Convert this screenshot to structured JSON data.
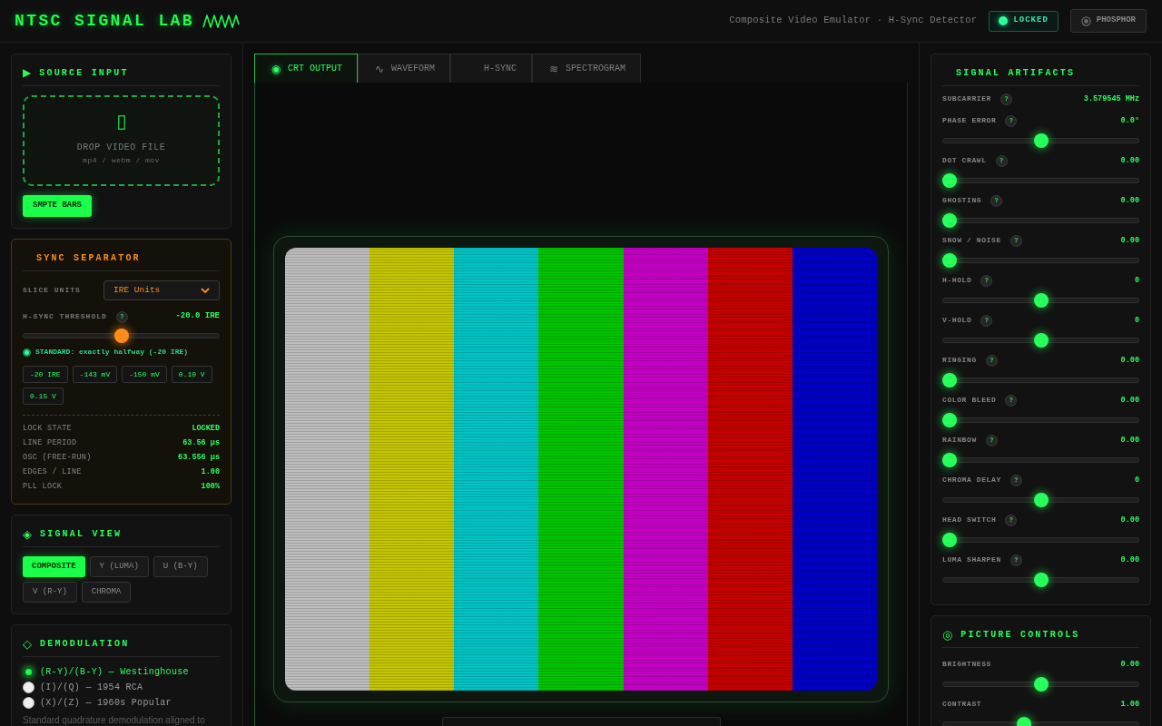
{
  "header": {
    "title": "NTSC SIGNAL LAB",
    "subtitle": "Composite Video Emulator · H-Sync Detector",
    "status": {
      "label": "LOCKED",
      "locked": true
    },
    "phosphor": {
      "label": "PHOSPHOR",
      "on": false
    }
  },
  "source_input": {
    "icon": "▶",
    "title": "SOURCE INPUT",
    "drop_zone": {
      "label": "DROP VIDEO FILE",
      "formats": "mp4 / webm / mov"
    },
    "button": {
      "label": "SMPTE BARS"
    }
  },
  "sync_separator": {
    "title": "SYNC SEPARATOR",
    "slice_units": {
      "label": "SLICE UNITS",
      "value": "IRE Units"
    },
    "threshold": {
      "label": "H-SYNC THRESHOLD",
      "help": "?",
      "reading": "-20.0 IRE",
      "level": 0.5
    },
    "standard": {
      "text": "STANDARD: exactly halfway (-20 IRE)",
      "on": true
    },
    "presets": [
      "-20 IRE",
      "-143 mV",
      "-150 mV",
      "0.10 V",
      "0.15 V"
    ],
    "stats": [
      {
        "label": "LOCK STATE",
        "value": "LOCKED"
      },
      {
        "label": "LINE PERIOD",
        "value": "63.56 µs"
      },
      {
        "label": "OSC (FREE-RUN)",
        "value": "63.556 µs"
      },
      {
        "label": "EDGES / LINE",
        "value": "1.00"
      },
      {
        "label": "PLL LOCK",
        "value": "100%"
      }
    ]
  },
  "signal_view": {
    "icon": "◈",
    "title": "SIGNAL VIEW",
    "options": [
      {
        "label": "COMPOSITE",
        "selected": true
      },
      {
        "label": "Y (LUMA)",
        "selected": false
      },
      {
        "label": "U (B-Y)",
        "selected": false
      },
      {
        "label": "V (R-Y)",
        "selected": false
      },
      {
        "label": "CHROMA",
        "selected": false
      }
    ]
  },
  "demodulation": {
    "icon": "◇",
    "title": "DEMODULATION",
    "options": [
      {
        "label": "(R-Y)/(B-Y) — Westinghouse",
        "selected": true
      },
      {
        "label": "(I)/(Q) — 1954 RCA",
        "selected": false
      },
      {
        "label": "(X)/(Z) — 1960s Popular",
        "selected": false
      }
    ],
    "description": "Standard quadrature demodulation aligned to"
  },
  "tabs": [
    {
      "icon": "◉",
      "label": "CRT OUTPUT",
      "selected": true
    },
    {
      "icon": "∿",
      "label": "WAVEFORM",
      "selected": false
    },
    {
      "label": "H-SYNC",
      "selected": false
    },
    {
      "icon": "≋",
      "label": "SPECTROGRAM",
      "selected": false
    }
  ],
  "crt": {
    "bars": [
      {
        "color": "#bdbdbd"
      },
      {
        "color": "#c4c400"
      },
      {
        "color": "#00c4c4"
      },
      {
        "color": "#00c400"
      },
      {
        "color": "#c400c4"
      },
      {
        "color": "#c40000"
      },
      {
        "color": "#0000c4"
      }
    ]
  },
  "signal_artifacts": {
    "title": "SIGNAL ARTIFACTS",
    "rows": [
      {
        "kind": "readout",
        "label": "SUBCARRIER",
        "help": "?",
        "reading": "3.579545 MHz"
      },
      {
        "kind": "slider",
        "label": "PHASE ERROR",
        "help": "?",
        "reading": "0.0°",
        "level": 0.5
      },
      {
        "kind": "slider",
        "label": "DOT CRAWL",
        "help": "?",
        "reading": "0.00",
        "level": 0
      },
      {
        "kind": "slider",
        "label": "GHOSTING",
        "help": "?",
        "reading": "0.00",
        "level": 0
      },
      {
        "kind": "slider",
        "label": "SNOW / NOISE",
        "help": "?",
        "reading": "0.00",
        "level": 0
      },
      {
        "kind": "slider",
        "label": "H-HOLD",
        "help": "?",
        "reading": "0",
        "level": 0.5
      },
      {
        "kind": "slider",
        "label": "V-HOLD",
        "help": "?",
        "reading": "0",
        "level": 0.5
      },
      {
        "kind": "slider",
        "label": "RINGING",
        "help": "?",
        "reading": "0.00",
        "level": 0
      },
      {
        "kind": "slider",
        "label": "COLOR BLEED",
        "help": "?",
        "reading": "0.00",
        "level": 0
      },
      {
        "kind": "slider",
        "label": "RAINBOW",
        "help": "?",
        "reading": "0.00",
        "level": 0
      },
      {
        "kind": "slider",
        "label": "CHROMA DELAY",
        "help": "?",
        "reading": "0",
        "level": 0.5
      },
      {
        "kind": "slider",
        "label": "HEAD SWITCH",
        "help": "?",
        "reading": "0.00",
        "level": 0
      },
      {
        "kind": "slider",
        "label": "LUMA SHARPEN",
        "help": "?",
        "reading": "0.00",
        "level": 0.5
      }
    ]
  },
  "picture_controls": {
    "icon": "◎",
    "title": "PICTURE CONTROLS",
    "rows": [
      {
        "kind": "slider",
        "label": "BRIGHTNESS",
        "reading": "0.00",
        "level": 0.5
      },
      {
        "kind": "slider",
        "label": "CONTRAST",
        "reading": "1.00",
        "level": 0.41
      }
    ]
  }
}
